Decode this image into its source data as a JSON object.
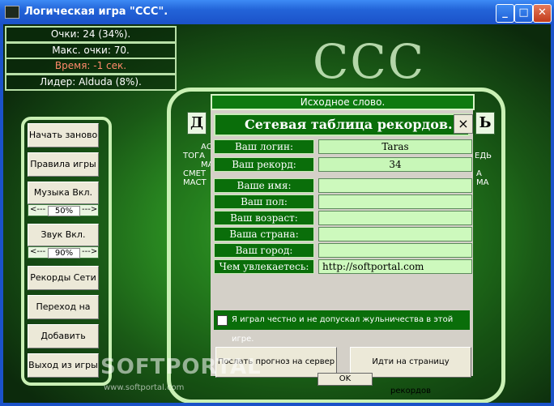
{
  "window": {
    "title": "Логическая игра \"ССС\".",
    "minimize": "_",
    "maximize": "□",
    "close": "✕"
  },
  "stats": {
    "score": "Очки: 24 (34%).",
    "max_score": "Макс. очки: 70.",
    "time": "Время: -1 сек.",
    "leader": "Лидер: Alduda (8%)."
  },
  "logo": "ССС",
  "menu": {
    "restart": "Начать заново",
    "rules": "Правила игры",
    "music": "Музыка Вкл.",
    "music_value": "50%",
    "sound": "Звук Вкл.",
    "sound_value": "90%",
    "arrow_left": "<---",
    "arrow_right": "--->",
    "net_records": "Рекорды Сети",
    "goto_site": "Переход на сайт",
    "add_word": "Добавить слово",
    "exit": "Выход из игры"
  },
  "game": {
    "source_word_label": "Исходное слово.",
    "letter_left": "Д",
    "letter_right": "Ь",
    "words_left": [
      "АС",
      "ТОГА",
      "МА",
      "СМЕТ",
      "МАСТ"
    ],
    "words_right": [
      "ЕДЬ",
      "А",
      "МА"
    ],
    "ok": "OK"
  },
  "dialog": {
    "title": "Сетевая таблица рекордов.",
    "close": "×",
    "fields": [
      {
        "label": "Ваш логин:",
        "value": "Taras"
      },
      {
        "label": "Ваш рекорд:",
        "value": "34"
      },
      {
        "label": "Ваше имя:",
        "value": ""
      },
      {
        "label": "Ваш пол:",
        "value": ""
      },
      {
        "label": "Ваш возраст:",
        "value": ""
      },
      {
        "label": "Ваша страна:",
        "value": ""
      },
      {
        "label": "Ваш город:",
        "value": ""
      },
      {
        "label": "Чем увлекаетесь:",
        "value": "http://softportal.com"
      }
    ],
    "honest_text": "Я играл честно и не допускал жульничества в этой игре.",
    "send_button": "Послать прогноз на сервер",
    "records_page_button": "Идти на страницу рекордов"
  },
  "watermark": {
    "brand": "SOFTPORTAL",
    "url": "www.softportal.com"
  }
}
